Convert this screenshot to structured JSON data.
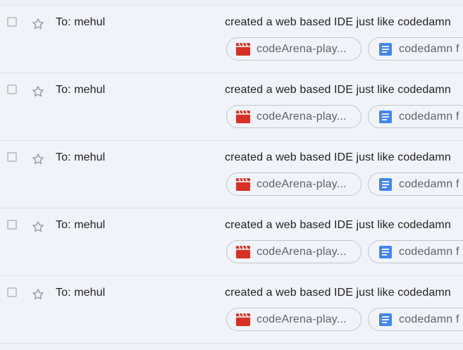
{
  "colors": {
    "background": "#f0f4fa",
    "video_icon": "#d93025",
    "doc_icon": "#4285f4",
    "divider": "#dde1e6"
  },
  "rows": [
    {
      "recipient": "To: mehul",
      "subject": "created a web based IDE just like codedamn",
      "attachments": [
        {
          "icon": "video-file-icon",
          "name": "codeArena-play..."
        },
        {
          "icon": "google-doc-icon",
          "name": "codedamn f"
        }
      ]
    },
    {
      "recipient": "To: mehul",
      "subject": "created a web based IDE just like codedamn",
      "attachments": [
        {
          "icon": "video-file-icon",
          "name": "codeArena-play..."
        },
        {
          "icon": "google-doc-icon",
          "name": "codedamn f"
        }
      ]
    },
    {
      "recipient": "To: mehul",
      "subject": "created a web based IDE just like codedamn",
      "attachments": [
        {
          "icon": "video-file-icon",
          "name": "codeArena-play..."
        },
        {
          "icon": "google-doc-icon",
          "name": "codedamn f"
        }
      ]
    },
    {
      "recipient": "To: mehul",
      "subject": "created a web based IDE just like codedamn",
      "attachments": [
        {
          "icon": "video-file-icon",
          "name": "codeArena-play..."
        },
        {
          "icon": "google-doc-icon",
          "name": "codedamn f"
        }
      ]
    },
    {
      "recipient": "To: mehul",
      "subject": "created a web based IDE just like codedamn",
      "attachments": [
        {
          "icon": "video-file-icon",
          "name": "codeArena-play..."
        },
        {
          "icon": "google-doc-icon",
          "name": "codedamn f"
        }
      ]
    }
  ]
}
